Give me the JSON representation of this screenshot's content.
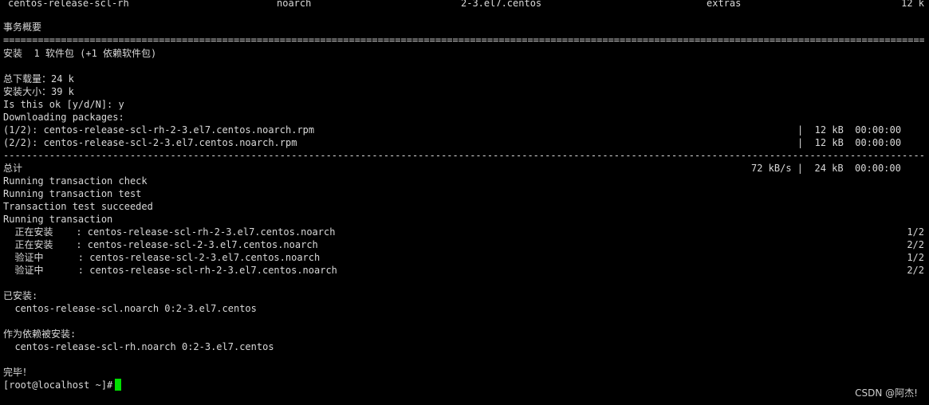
{
  "header_row": {
    "name": "centos-release-scl-rh",
    "arch": "noarch",
    "version": "2-3.el7.centos",
    "repo": "extras",
    "size": "12 k"
  },
  "summary_title": "事务概要",
  "install_summary": "安装  1 软件包 (+1 依赖软件包)",
  "total_download": "总下载量：24 k",
  "install_size": "安装大小：39 k",
  "prompt_confirm": "Is this ok [y/d/N]: y",
  "downloading": "Downloading packages:",
  "downloads": [
    {
      "file": "(1/2): centos-release-scl-rh-2-3.el7.centos.noarch.rpm",
      "stats": "|  12 kB  00:00:00"
    },
    {
      "file": "(2/2): centos-release-scl-2-3.el7.centos.noarch.rpm",
      "stats": "|  12 kB  00:00:00"
    }
  ],
  "total_label": "总计",
  "total_stats": "72 kB/s |  24 kB  00:00:00",
  "transaction_lines": [
    "Running transaction check",
    "Running transaction test",
    "Transaction test succeeded",
    "Running transaction"
  ],
  "steps": [
    {
      "action": "  正在安装    : centos-release-scl-rh-2-3.el7.centos.noarch",
      "count": "1/2"
    },
    {
      "action": "  正在安装    : centos-release-scl-2-3.el7.centos.noarch",
      "count": "2/2"
    },
    {
      "action": "  验证中      : centos-release-scl-2-3.el7.centos.noarch",
      "count": "1/2"
    },
    {
      "action": "  验证中      : centos-release-scl-rh-2-3.el7.centos.noarch",
      "count": "2/2"
    }
  ],
  "installed_label": "已安装:",
  "installed_pkg": "  centos-release-scl.noarch 0:2-3.el7.centos",
  "dep_label": "作为依赖被安装:",
  "dep_pkg": "  centos-release-scl-rh.noarch 0:2-3.el7.centos",
  "done": "完毕！",
  "prompt": "[root@localhost ~]# ",
  "watermark": "CSDN @阿杰!",
  "colors": {
    "background": "#000000",
    "text": "#d9d9d9",
    "cursor": "#00e000"
  }
}
